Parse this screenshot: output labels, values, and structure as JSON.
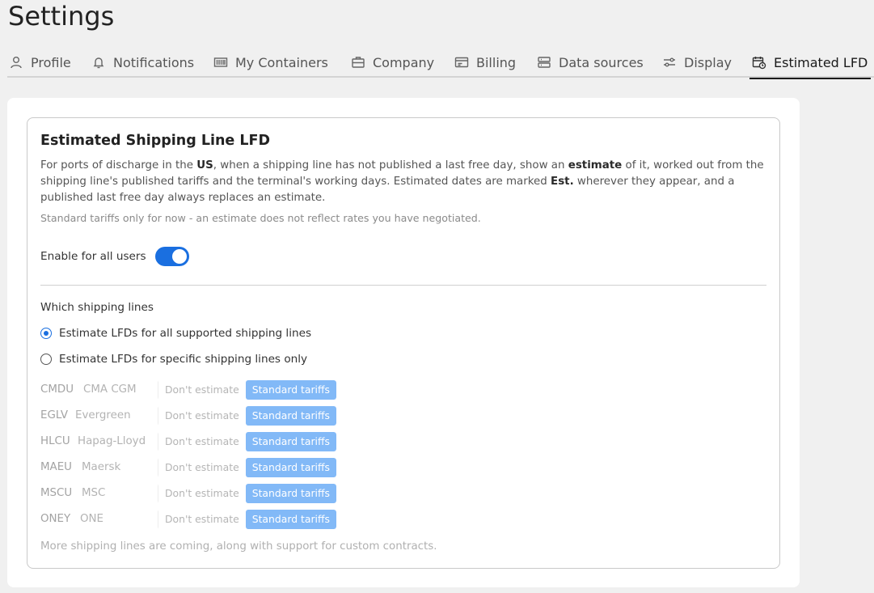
{
  "page": {
    "title": "Settings"
  },
  "tabs": [
    {
      "label": "Profile",
      "icon": "user-icon"
    },
    {
      "label": "Notifications",
      "icon": "bell-icon"
    },
    {
      "label": "My Containers",
      "icon": "barcode-icon"
    },
    {
      "label": "Company",
      "icon": "briefcase-icon"
    },
    {
      "label": "Billing",
      "icon": "invoice-icon"
    },
    {
      "label": "Data sources",
      "icon": "server-icon"
    },
    {
      "label": "Display",
      "icon": "sliders-icon"
    },
    {
      "label": "Estimated LFD",
      "icon": "calendar-clock-icon",
      "active": true
    }
  ],
  "section": {
    "title": "Estimated Shipping Line LFD",
    "desc": {
      "p1": "For ports of discharge in the ",
      "b1": "US",
      "p2": ", when a shipping line has not published a last free day, show an ",
      "b2": "estimate",
      "p3": " of it, worked out from the shipping line's published tariffs and the terminal's working days. Estimated dates are marked ",
      "b3": "Est.",
      "p4": " wherever they appear, and a published last free day always replaces an estimate."
    },
    "note": "Standard tariffs only for now - an estimate does not reflect rates you have negotiated.",
    "enable_label": "Enable for all users",
    "enabled": true,
    "which_title": "Which shipping lines",
    "radio_all": "Estimate LFDs for all supported shipping lines",
    "radio_specific": "Estimate LFDs for specific shipping lines only",
    "selected_option": "all",
    "option_off_label": "Don't estimate",
    "option_on_label": "Standard tariffs",
    "lines": [
      {
        "code": "CMDU",
        "name": "CMA CGM"
      },
      {
        "code": "EGLV",
        "name": "Evergreen"
      },
      {
        "code": "HLCU",
        "name": "Hapag-Lloyd"
      },
      {
        "code": "MAEU",
        "name": "Maersk"
      },
      {
        "code": "MSCU",
        "name": "MSC"
      },
      {
        "code": "ONEY",
        "name": "ONE"
      }
    ],
    "footer": "More shipping lines are coming, along with support for custom contracts."
  },
  "colors": {
    "accent": "#1a6fe0",
    "segment_on": "#82b9f7"
  }
}
